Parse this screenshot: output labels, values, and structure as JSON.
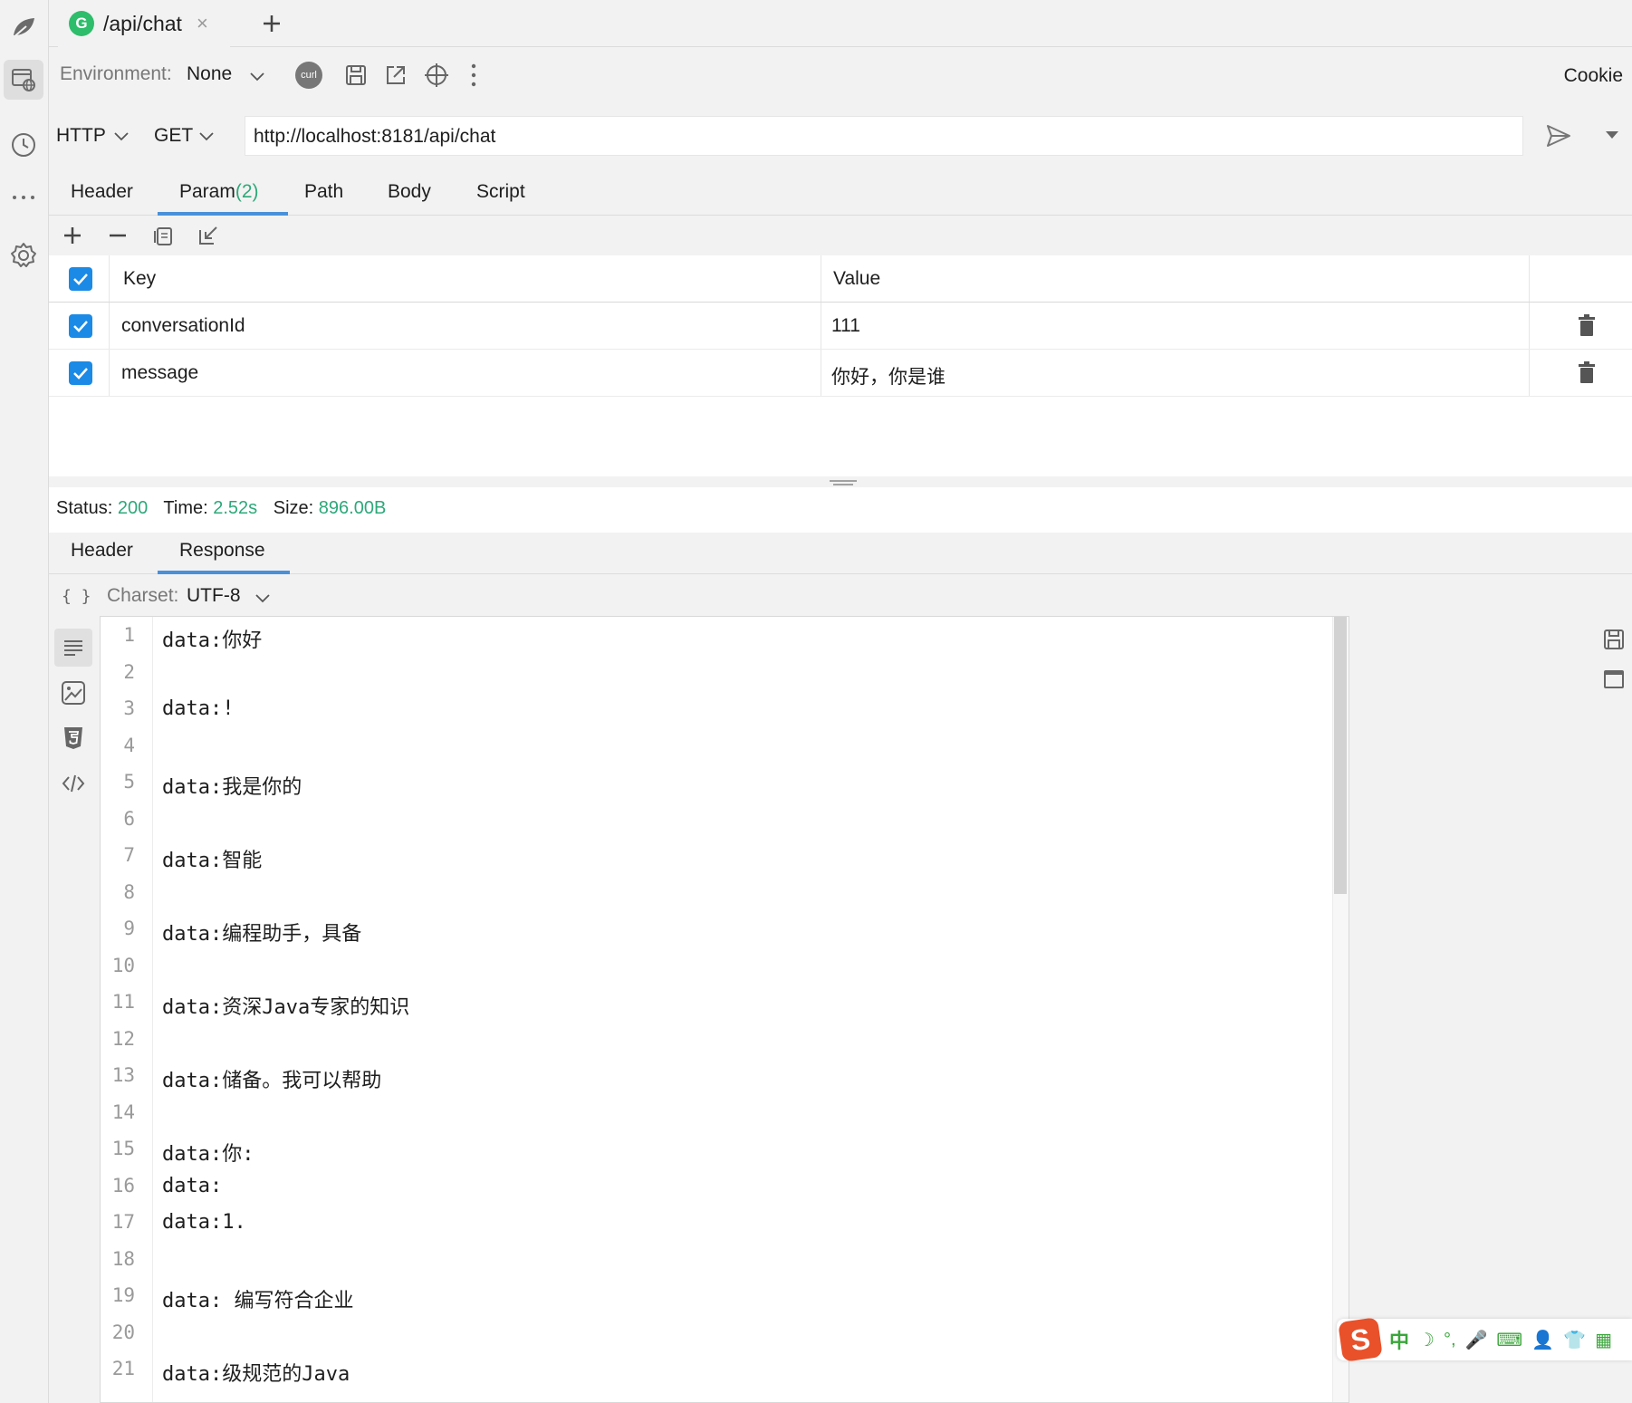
{
  "tab": {
    "badge": "G",
    "title": "/api/chat",
    "close": "×",
    "new_tab": "+"
  },
  "env": {
    "label": "Environment:",
    "value": "None",
    "cookie": "Cookie",
    "curl_label": "curl"
  },
  "request": {
    "protocol": "HTTP",
    "method": "GET",
    "url": "http://localhost:8181/api/chat"
  },
  "request_tabs": [
    {
      "label": "Header",
      "count": ""
    },
    {
      "label": "Param",
      "count": "(2)"
    },
    {
      "label": "Path",
      "count": ""
    },
    {
      "label": "Body",
      "count": ""
    },
    {
      "label": "Script",
      "count": ""
    }
  ],
  "params": {
    "headers": {
      "key": "Key",
      "value": "Value"
    },
    "rows": [
      {
        "checked": true,
        "key": "conversationId",
        "value": "111"
      },
      {
        "checked": true,
        "key": "message",
        "value": "你好，你是谁"
      }
    ]
  },
  "status": {
    "status_label": "Status:",
    "status_value": "200",
    "time_label": "Time:",
    "time_value": "2.52s",
    "size_label": "Size:",
    "size_value": "896.00B"
  },
  "response_tabs": [
    {
      "label": "Header"
    },
    {
      "label": "Response"
    }
  ],
  "response": {
    "format_icon_text": "{ }",
    "charset_label": "Charset:",
    "charset_value": "UTF-8",
    "lines": [
      {
        "n": "1",
        "text": "data:你好"
      },
      {
        "n": "2",
        "text": ""
      },
      {
        "n": "3",
        "text": "data:!"
      },
      {
        "n": "4",
        "text": ""
      },
      {
        "n": "5",
        "text": "data:我是你的"
      },
      {
        "n": "6",
        "text": ""
      },
      {
        "n": "7",
        "text": "data:智能"
      },
      {
        "n": "8",
        "text": ""
      },
      {
        "n": "9",
        "text": "data:编程助手，具备"
      },
      {
        "n": "10",
        "text": ""
      },
      {
        "n": "11",
        "text": "data:资深Java专家的知识"
      },
      {
        "n": "12",
        "text": ""
      },
      {
        "n": "13",
        "text": "data:储备。我可以帮助"
      },
      {
        "n": "14",
        "text": ""
      },
      {
        "n": "15",
        "text": "data:你:"
      },
      {
        "n": "16",
        "text": "data:"
      },
      {
        "n": "17",
        "text": "data:1."
      },
      {
        "n": "18",
        "text": ""
      },
      {
        "n": "19",
        "text": "data: 编写符合企业"
      },
      {
        "n": "20",
        "text": ""
      },
      {
        "n": "21",
        "text": "data:级规范的Java"
      }
    ]
  },
  "ime": {
    "logo": "S",
    "mode": "中",
    "moon": "☽",
    "punct": "°,",
    "mic": "🎤",
    "keyboard": "⌨",
    "user": "👤",
    "shirt": "👕",
    "grid": "▦"
  },
  "colors": {
    "accent": "#4a90d9",
    "success": "#2ea87a",
    "checkbox": "#1a8ae6",
    "badge": "#2ebd6b"
  }
}
